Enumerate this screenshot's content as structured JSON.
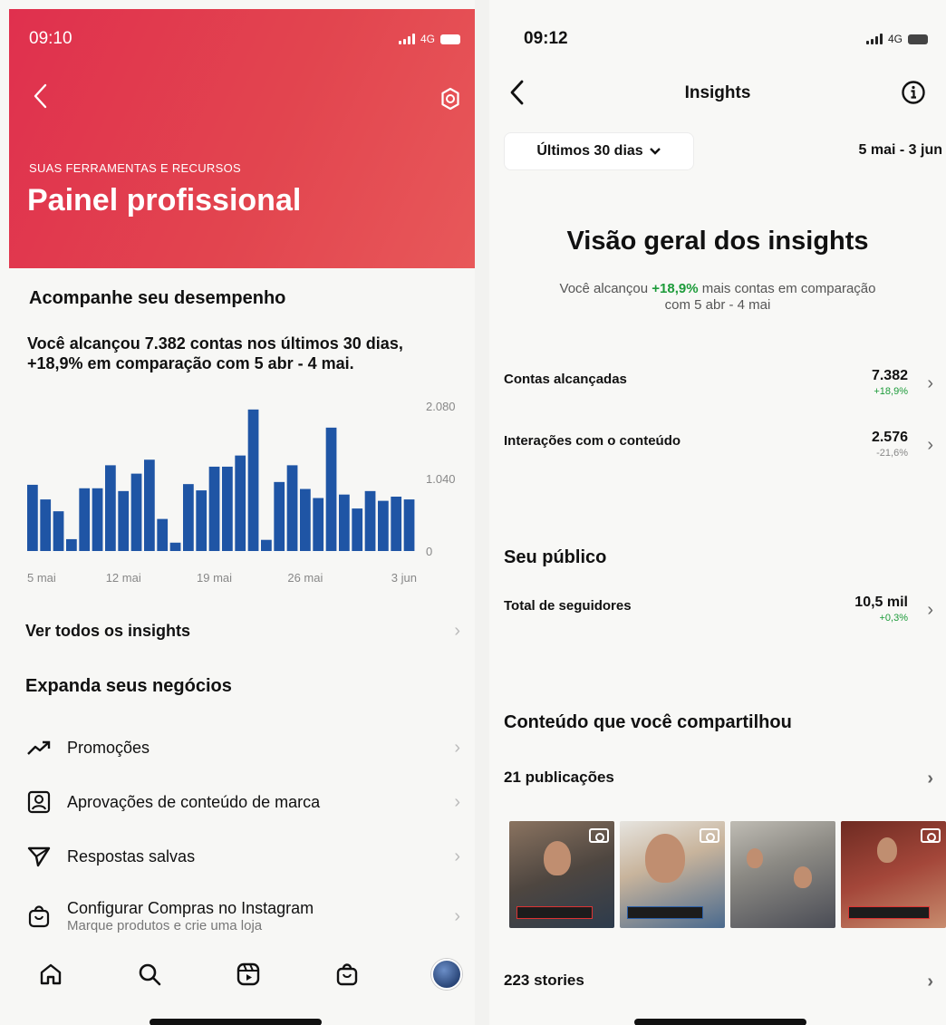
{
  "left": {
    "status": {
      "time": "09:10",
      "network": "4G"
    },
    "hero": {
      "kicker": "SUAS FERRAMENTAS E RECURSOS",
      "title": "Painel profissional",
      "color": "#e0304e"
    },
    "performance": {
      "title": "Acompanhe seu desempenho",
      "line1": "Você alcançou 7.382 contas nos últimos 30 dias,",
      "line2": "+18,9% em comparação com 5 abr - 4 mai."
    },
    "chart_data": {
      "type": "bar",
      "title": "",
      "xlabel": "",
      "ylabel": "",
      "ylim": [
        0,
        2080
      ],
      "y_ticks": [
        "2.080",
        "1.040",
        "0"
      ],
      "x_ticks": [
        "5 mai",
        "12 mai",
        "19 mai",
        "26 mai",
        "3 jun"
      ],
      "x_tick_index": [
        0,
        7,
        14,
        21,
        28
      ],
      "bar_color": "#1f55a5",
      "values": [
        950,
        740,
        570,
        170,
        900,
        900,
        1230,
        860,
        1110,
        1310,
        460,
        120,
        960,
        870,
        1210,
        1210,
        1370,
        2030,
        160,
        990,
        1230,
        890,
        760,
        1770,
        810,
        610,
        860,
        720,
        780,
        740
      ]
    },
    "see_all": "Ver todos os insights",
    "expand_title": "Expanda seus negócios",
    "menu": [
      {
        "label": "Promoções",
        "icon": "trend-up-icon"
      },
      {
        "label": "Aprovações de conteúdo de marca",
        "icon": "branded-content-icon"
      },
      {
        "label": "Respostas salvas",
        "icon": "send-icon"
      },
      {
        "label": "Configurar Compras no Instagram",
        "sub": "Marque produtos e crie uma loja",
        "icon": "shopping-bag-icon"
      }
    ],
    "tabs": [
      "home-icon",
      "search-icon",
      "reels-icon",
      "shop-icon",
      "profile-avatar"
    ]
  },
  "right": {
    "status": {
      "time": "09:12",
      "network": "4G"
    },
    "title": "Insights",
    "period": "Últimos 30 dias",
    "date_range": "5 mai - 3 jun",
    "overview": {
      "title": "Visão geral dos insights",
      "pre": "Você alcançou ",
      "highlight": "+18,9%",
      "post": " mais contas em comparação",
      "line2": "com 5 abr - 4 mai"
    },
    "metrics": [
      {
        "label": "Contas alcançadas",
        "value": "7.382",
        "change": "+18,9%"
      },
      {
        "label": "Interações com o conteúdo",
        "value": "2.576",
        "change": "-21,6%"
      }
    ],
    "audience": {
      "title": "Seu público",
      "label": "Total de seguidores",
      "value": "10,5 mil",
      "change": "+0,3%"
    },
    "content": {
      "title": "Conteúdo que você compartilhou",
      "posts": "21 publicações",
      "stories": "223 stories"
    },
    "accent_green": "#1d9b3a"
  }
}
